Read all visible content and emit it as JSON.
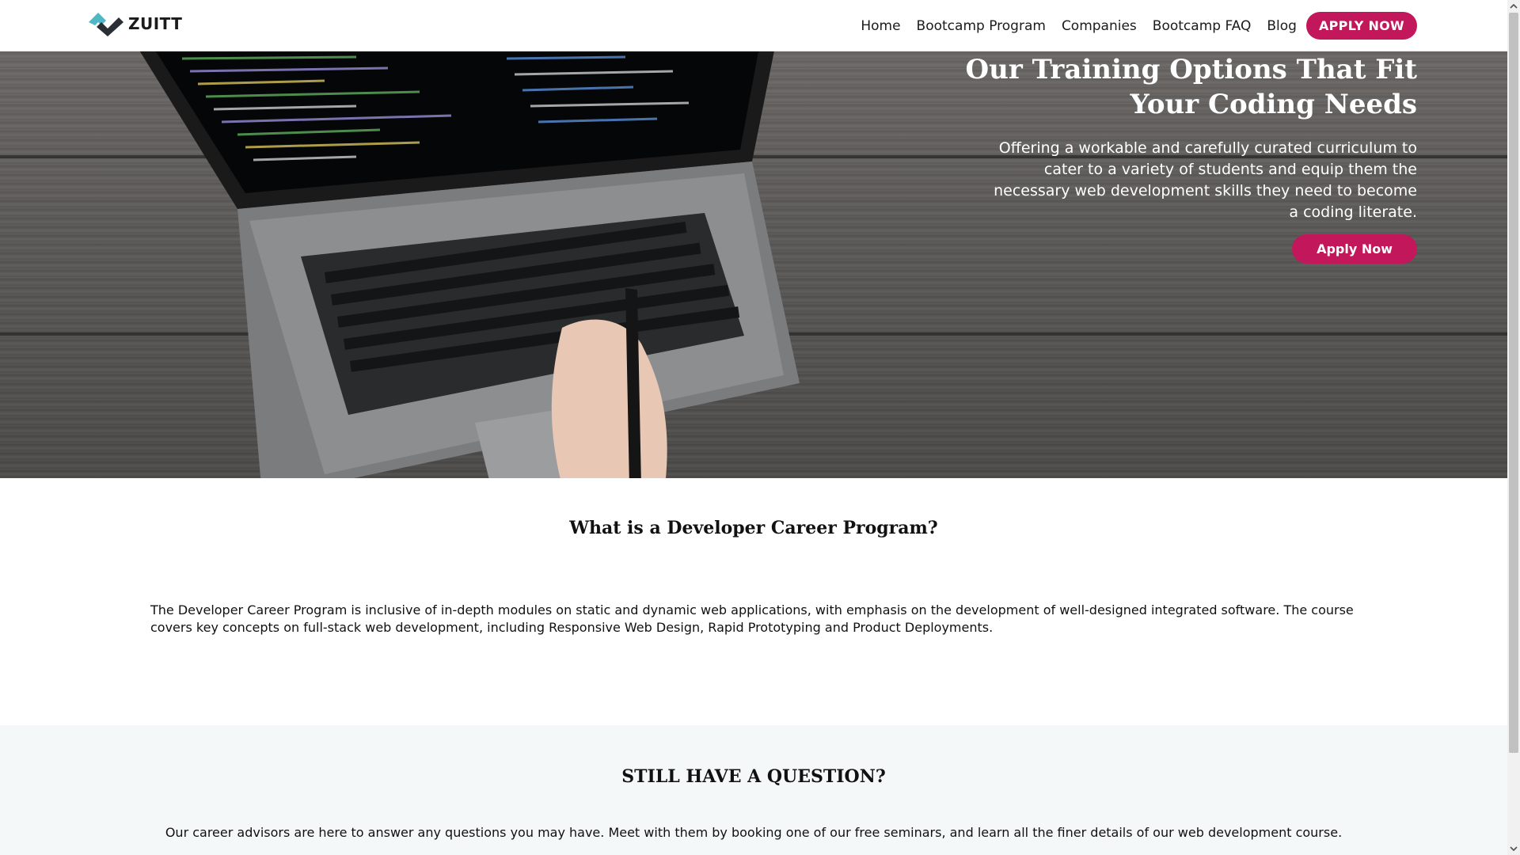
{
  "header": {
    "logo_text": "ZUITT",
    "nav": [
      "Home",
      "Bootcamp Program",
      "Companies",
      "Bootcamp FAQ",
      "Blog"
    ],
    "cta": "APPLY NOW"
  },
  "hero": {
    "title": "Our Training Options That Fit Your Coding Needs",
    "subtitle": "Offering a workable and carefully curated curriculum to cater to a variety of students and equip them the necessary web development skills they need to become a coding literate.",
    "button": "Apply Now"
  },
  "what": {
    "title": "What is a Developer Career Program?",
    "body": "The Developer Career Program is inclusive of in-depth modules on static and dynamic web applications, with emphasis on the development of well-designed integrated software. The course covers key concepts on full-stack web development, including Responsive Web Design, Rapid Prototyping and Product Deployments."
  },
  "question": {
    "title": "STILL HAVE A QUESTION?",
    "body": "Our career advisors are here to answer any questions you may have. Meet with them by booking one of our free seminars, and learn all the finer details of our web development course."
  },
  "colors": {
    "accent": "#c2185b",
    "logo_teal": "#4fb8c4",
    "logo_dark": "#2a2f35",
    "section_bg": "#f4f8f9"
  }
}
